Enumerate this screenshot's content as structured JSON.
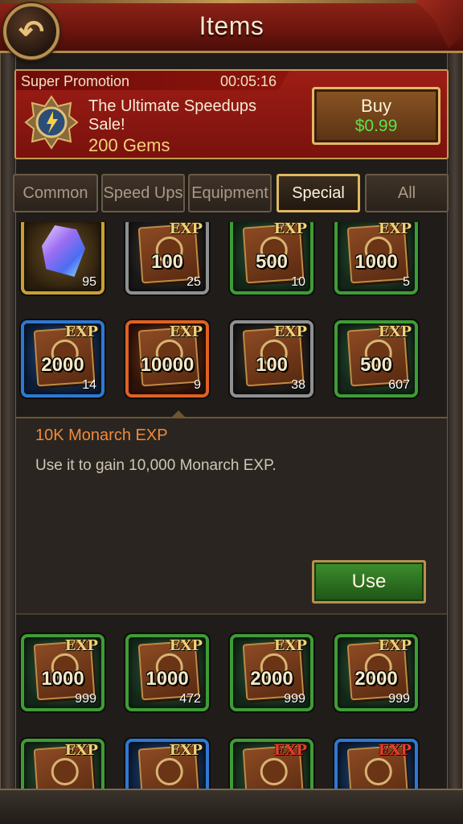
{
  "header": {
    "title": "Items",
    "back_icon": "back-arrow-icon"
  },
  "promo": {
    "label": "Super Promotion",
    "timer": "00:05:16",
    "title": "The Ultimate Speedups Sale!",
    "gems": "200 Gems",
    "buy_label": "Buy",
    "price": "$0.99"
  },
  "tabs": [
    {
      "label": "Common",
      "active": false
    },
    {
      "label": "Speed Ups",
      "active": false
    },
    {
      "label": "Equipment",
      "active": false
    },
    {
      "label": "Special",
      "active": true
    },
    {
      "label": "All",
      "active": false
    }
  ],
  "items": {
    "row1": [
      {
        "icon": "crystal-icon",
        "value": "",
        "count": "95",
        "frame": "gold"
      },
      {
        "icon": "exp-book-icon",
        "value": "100",
        "count": "25",
        "frame": "gray"
      },
      {
        "icon": "exp-book-icon",
        "value": "500",
        "count": "10",
        "frame": "green"
      },
      {
        "icon": "exp-book-icon",
        "value": "1000",
        "count": "5",
        "frame": "green"
      }
    ],
    "row2": [
      {
        "icon": "exp-book-icon",
        "value": "2000",
        "count": "14",
        "frame": "blue"
      },
      {
        "icon": "exp-book-icon",
        "value": "10000",
        "count": "9",
        "frame": "orange"
      },
      {
        "icon": "exp-book-icon",
        "value": "100",
        "count": "38",
        "frame": "gray"
      },
      {
        "icon": "exp-book-icon",
        "value": "500",
        "count": "607",
        "frame": "green"
      }
    ],
    "row3": [
      {
        "icon": "exp-book-icon",
        "value": "1000",
        "count": "999",
        "frame": "green"
      },
      {
        "icon": "exp-book-icon",
        "value": "1000",
        "count": "472",
        "frame": "green"
      },
      {
        "icon": "exp-book-icon",
        "value": "2000",
        "count": "999",
        "frame": "green"
      },
      {
        "icon": "exp-book-icon",
        "value": "2000",
        "count": "999",
        "frame": "green"
      }
    ],
    "row4": [
      {
        "icon": "exp-book-icon",
        "frame": "green"
      },
      {
        "icon": "exp-book-icon",
        "frame": "blue"
      },
      {
        "icon": "exp-book-icon",
        "frame": "green"
      },
      {
        "icon": "exp-book-icon",
        "frame": "blue"
      }
    ],
    "exp_tag": "EXP"
  },
  "detail": {
    "title": "10K Monarch EXP",
    "description": "Use it to gain 10,000 Monarch EXP.",
    "use_label": "Use"
  }
}
